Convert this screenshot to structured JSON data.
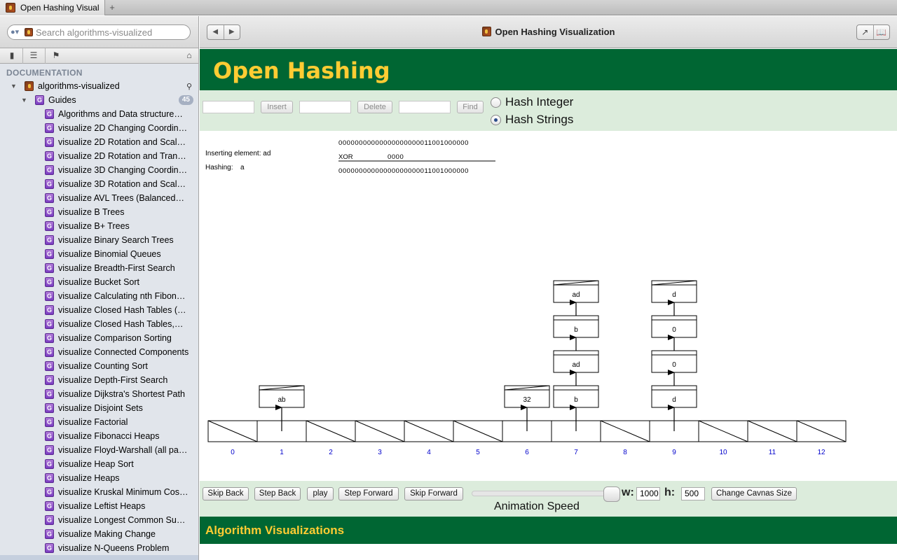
{
  "window": {
    "tab_title": "Open Hashing Visual",
    "tab_add": "+"
  },
  "sidebar": {
    "search_placeholder": "Search algorithms-visualized",
    "section": "DOCUMENTATION",
    "docset": "algorithms-visualized",
    "group": "Guides",
    "group_count": "45",
    "items": [
      "Algorithms and Data structure…",
      "visualize 2D Changing Coordin…",
      "visualize 2D Rotation and Scal…",
      "visualize 2D Rotation and Tran…",
      "visualize 3D Changing Coordin…",
      "visualize 3D Rotation and Scal…",
      "visualize AVL Trees (Balanced…",
      "visualize B Trees",
      "visualize B+ Trees",
      "visualize Binary Search Trees",
      "visualize Binomial Queues",
      "visualize Breadth-First Search",
      "visualize Bucket Sort",
      "visualize Calculating nth Fibon…",
      "visualize Closed Hash Tables (…",
      "visualize Closed Hash Tables,…",
      "visualize Comparison Sorting",
      "visualize Connected Components",
      "visualize Counting Sort",
      "visualize Depth-First Search",
      "visualize Dijkstra's Shortest Path",
      "visualize Disjoint Sets",
      "visualize Factorial",
      "visualize Fibonacci Heaps",
      "visualize Floyd-Warshall (all pa…",
      "visualize Heap Sort",
      "visualize Heaps",
      "visualize Kruskal Minimum Cos…",
      "visualize Leftist Heaps",
      "visualize Longest Common Su…",
      "visualize Making Change",
      "visualize N-Queens Problem"
    ]
  },
  "header": {
    "back": "◀",
    "forward": "▶",
    "page_title": "Open Hashing Visualization"
  },
  "page": {
    "title": "Open Hashing",
    "controls": {
      "insert_label": "Insert",
      "delete_label": "Delete",
      "find_label": "Find",
      "radio_integer": "Hash Integer",
      "radio_strings": "Hash Strings",
      "selected": "Hash Strings"
    },
    "status": {
      "inserting": "Inserting element: ad",
      "hashing_label": "Hashing:",
      "hashing_value": "a",
      "bits_top": "00000000000000000000011001000000",
      "xor_label": "XOR",
      "xor_value": "0000",
      "bits_bottom": "00000000000000000000011001000000"
    },
    "hash_table": {
      "indices": [
        "0",
        "1",
        "2",
        "3",
        "4",
        "5",
        "6",
        "7",
        "8",
        "9",
        "10",
        "11",
        "12"
      ],
      "chains": {
        "1": [
          "ab"
        ],
        "6": [
          "32"
        ],
        "7": [
          "b",
          "ad",
          "b",
          "ad"
        ],
        "9": [
          "d",
          "0",
          "0",
          "d"
        ]
      }
    },
    "animation": {
      "skip_back": "Skip Back",
      "step_back": "Step Back",
      "play": "play",
      "step_forward": "Step Forward",
      "skip_forward": "Skip Forward",
      "speed_label": "Animation Speed",
      "speed_level": 0.94,
      "w_label": "w:",
      "w_value": "1000",
      "h_label": "h:",
      "h_value": "500",
      "change_size": "Change Cavnas Size"
    },
    "footer_title": "Algorithm Visualizations"
  },
  "colors": {
    "banner_green": "#006633",
    "banner_text": "#ffcc33",
    "panel_green": "#dcecdc",
    "index_blue": "#0000cc"
  }
}
